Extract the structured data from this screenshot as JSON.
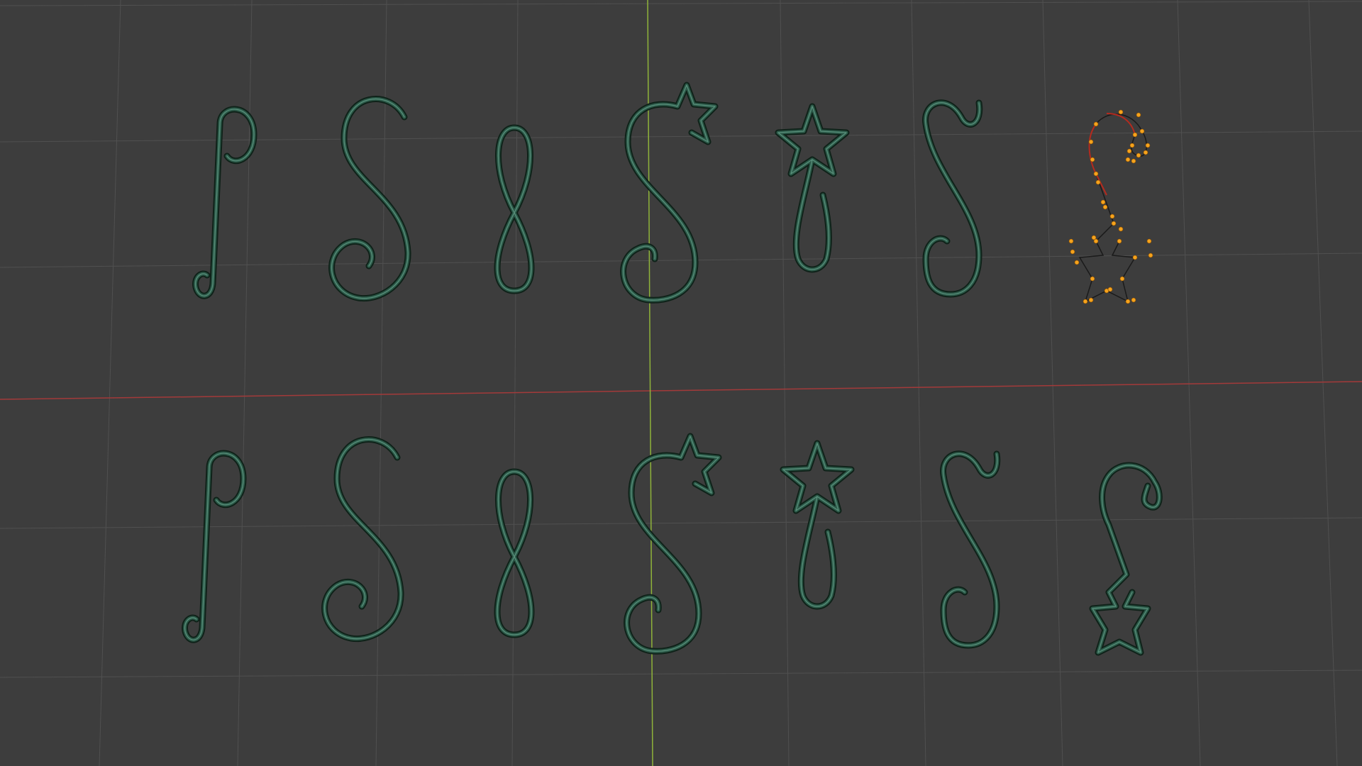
{
  "viewport": {
    "background": "#3d3d3d",
    "grid_color": "#595959",
    "x_axis_color": "#a33a3a",
    "y_axis_color": "#8fb33a",
    "wire_color": "#2c5a49",
    "selection_color": "#f5a31d"
  },
  "objects": {
    "row_top": [
      "j-hook",
      "s-spiral",
      "figure-eight",
      "s-star",
      "star-drop",
      "long-s",
      "star-hook-edit-mode"
    ],
    "row_bottom": [
      "j-hook",
      "s-spiral",
      "figure-eight",
      "s-star",
      "star-drop",
      "long-s",
      "star-hook"
    ]
  }
}
